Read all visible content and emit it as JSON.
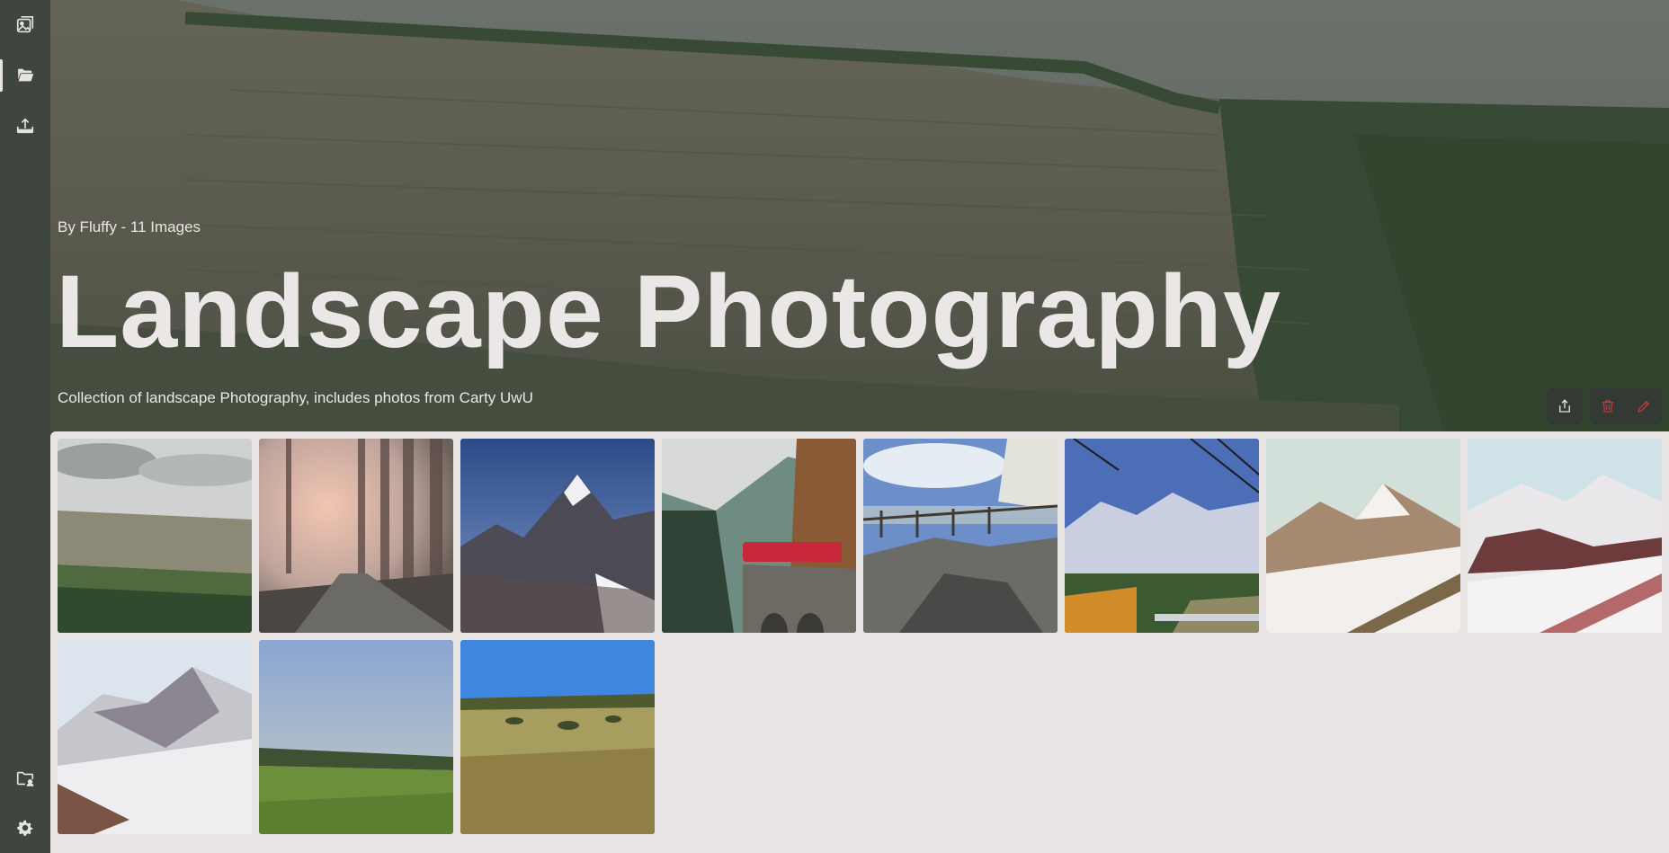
{
  "sidebar": {
    "top_items": [
      {
        "icon": "image-icon",
        "name": "sidebar-item-images"
      },
      {
        "icon": "folder-open-icon",
        "name": "sidebar-item-albums",
        "active": true
      },
      {
        "icon": "upload-icon",
        "name": "sidebar-item-upload"
      }
    ],
    "bottom_items": [
      {
        "icon": "folder-user-icon",
        "name": "sidebar-item-shared"
      },
      {
        "icon": "gear-icon",
        "name": "sidebar-item-settings"
      }
    ]
  },
  "album": {
    "meta": "By Fluffy - 11 Images",
    "title": "Landscape Photography",
    "description": "Collection of landscape Photography, includes photos from Carty UwU"
  },
  "actions": {
    "share_icon": "share-icon",
    "delete_icon": "trash-icon",
    "edit_icon": "pencil-icon"
  },
  "colors": {
    "sidebar_bg": "#3f463f",
    "gallery_bg": "#e8e4e3",
    "text_light": "#ebe7e7",
    "danger": "#c0393b"
  },
  "images": [
    {
      "id": 1,
      "scene": "cliff-forest"
    },
    {
      "id": 2,
      "scene": "misty-forest-path"
    },
    {
      "id": 3,
      "scene": "mountain-peak-blue-sky"
    },
    {
      "id": 4,
      "scene": "red-train-viaduct"
    },
    {
      "id": 5,
      "scene": "rocks-fence-coast"
    },
    {
      "id": 6,
      "scene": "alpine-cable-view"
    },
    {
      "id": 7,
      "scene": "snowy-peak-sunset"
    },
    {
      "id": 8,
      "scene": "snowy-ridge"
    },
    {
      "id": 9,
      "scene": "snowy-mountains"
    },
    {
      "id": 10,
      "scene": "green-meadow-haze"
    },
    {
      "id": 11,
      "scene": "grassland-blue-sky"
    }
  ]
}
